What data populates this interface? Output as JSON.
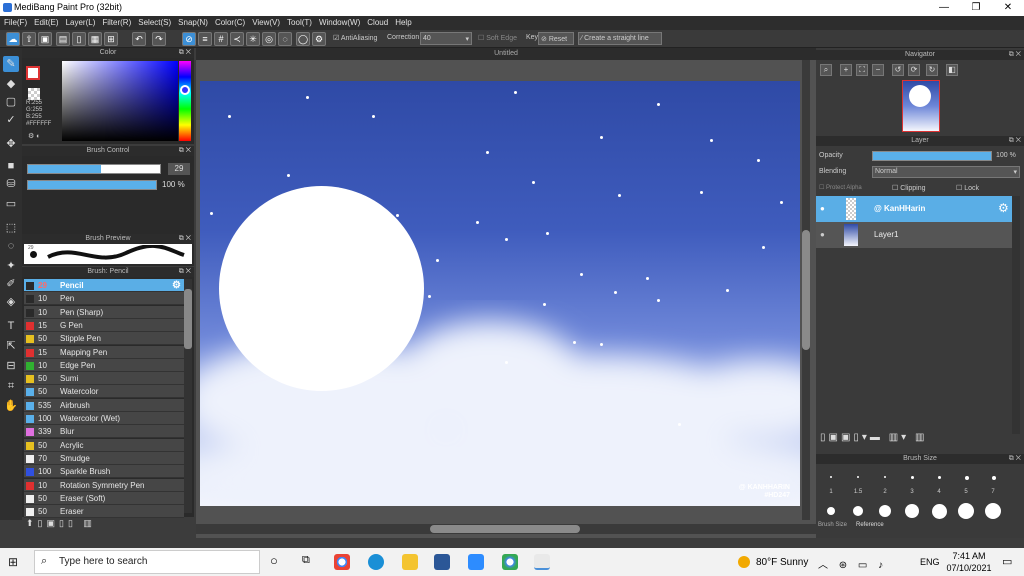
{
  "window": {
    "title": "MediBang Paint Pro (32bit)",
    "minimize": "—",
    "maximize": "❐",
    "close": "✕"
  },
  "menu": [
    "File(F)",
    "Edit(E)",
    "Layer(L)",
    "Filter(R)",
    "Select(S)",
    "Snap(N)",
    "Color(C)",
    "View(V)",
    "Tool(T)",
    "Window(W)",
    "Cloud",
    "Help"
  ],
  "toolbar": {
    "antialiasing": "AntiAliasing",
    "correction_label": "Correction",
    "correction_value": "40",
    "soft_edge": "Soft Edge",
    "key": "Key",
    "reset": "Reset",
    "straight_line": "Create a straight line"
  },
  "color_panel": {
    "title": "Color",
    "rgb": [
      "R:255",
      "G:255",
      "B:255"
    ],
    "hex": "#FFFFFF"
  },
  "brush_control": {
    "title": "Brush Control",
    "size": "29",
    "size_fraction": 0.55,
    "opacity": "100 %",
    "opacity_fraction": 1.0
  },
  "brush_preview": {
    "title": "Brush Preview",
    "size": "29"
  },
  "brush_list": {
    "title": "Brush: Pencil",
    "items": [
      {
        "size": "29",
        "name": "Pencil",
        "color": "#2a2a2a",
        "selected": true
      },
      {
        "size": "10",
        "name": "Pen",
        "color": "#2a2a2a"
      },
      {
        "size": "10",
        "name": "Pen (Sharp)",
        "color": "#2a2a2a"
      },
      {
        "size": "15",
        "name": "G Pen",
        "color": "#e03030"
      },
      {
        "size": "50",
        "name": "Stipple Pen",
        "color": "#e6c020"
      },
      {
        "size": "15",
        "name": "Mapping Pen",
        "color": "#e03030"
      },
      {
        "size": "10",
        "name": "Edge Pen",
        "color": "#30b030"
      },
      {
        "size": "50",
        "name": "Sumi",
        "color": "#e6c020"
      },
      {
        "size": "50",
        "name": "Watercolor",
        "color": "#5ab0ea"
      },
      {
        "size": "535",
        "name": "Airbrush",
        "color": "#5ab0ea"
      },
      {
        "size": "100",
        "name": "Watercolor (Wet)",
        "color": "#5ab0ea"
      },
      {
        "size": "339",
        "name": "Blur",
        "color": "#e070e0"
      },
      {
        "size": "50",
        "name": "Acrylic",
        "color": "#e6c020"
      },
      {
        "size": "70",
        "name": "Smudge",
        "color": "#f0f0f0"
      },
      {
        "size": "100",
        "name": "Sparkle Brush",
        "color": "#3050e0"
      },
      {
        "size": "10",
        "name": "Rotation Symmetry Pen",
        "color": "#e03030"
      },
      {
        "size": "50",
        "name": "Eraser (Soft)",
        "color": "#f0f0f0"
      },
      {
        "size": "50",
        "name": "Eraser",
        "color": "#f0f0f0"
      }
    ]
  },
  "canvas": {
    "title": "Untitled",
    "signature_line1": "@ KANHHARIN",
    "signature_line2": "#HD247"
  },
  "navigator": {
    "title": "Navigator"
  },
  "layer_panel": {
    "title": "Layer",
    "opacity_label": "Opacity",
    "opacity_value": "100 %",
    "blending_label": "Blending",
    "blending_value": "Normal",
    "protect_alpha": "Protect Alpha",
    "clipping": "Clipping",
    "lock": "Lock",
    "layers": [
      {
        "name": "@ KanHHarin",
        "selected": true
      },
      {
        "name": "Layer1",
        "selected": false
      }
    ]
  },
  "brush_size": {
    "title": "Brush Size",
    "labels": [
      "1",
      "1.5",
      "2",
      "3",
      "4",
      "5",
      "7"
    ],
    "tabs": [
      "Brush Size",
      "Reference"
    ]
  },
  "taskbar": {
    "search_placeholder": "Type here to search",
    "weather": "80°F  Sunny",
    "lang": "ENG",
    "time": "7:41 AM",
    "date": "07/10/2021"
  }
}
